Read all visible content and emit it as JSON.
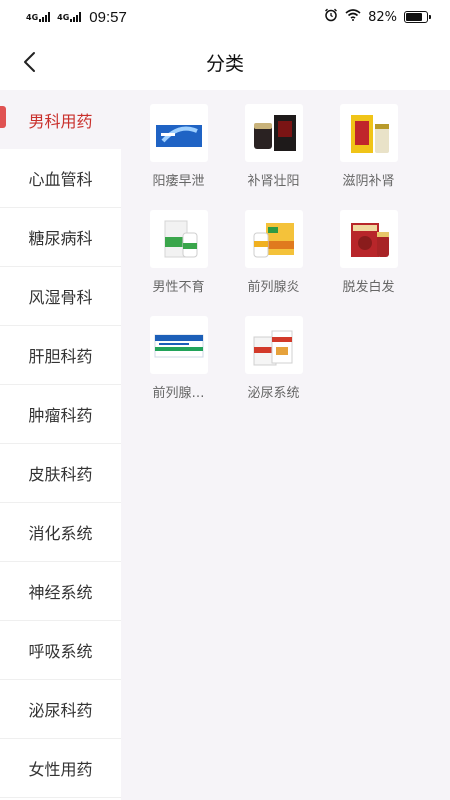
{
  "status_bar": {
    "net1": "4G",
    "net2": "4G",
    "time": "09:57",
    "battery": "82%",
    "battery_level": 0.82
  },
  "header": {
    "title": "分类"
  },
  "sidebar": {
    "items": [
      {
        "label": "男科用药",
        "active": true
      },
      {
        "label": "心血管科",
        "active": false
      },
      {
        "label": "糖尿病科",
        "active": false
      },
      {
        "label": "风湿骨科",
        "active": false
      },
      {
        "label": "肝胆科药",
        "active": false
      },
      {
        "label": "肿瘤科药",
        "active": false
      },
      {
        "label": "皮肤科药",
        "active": false
      },
      {
        "label": "消化系统",
        "active": false
      },
      {
        "label": "神经系统",
        "active": false
      },
      {
        "label": "呼吸系统",
        "active": false
      },
      {
        "label": "泌尿科药",
        "active": false
      },
      {
        "label": "女性用药",
        "active": false
      }
    ]
  },
  "categories": [
    {
      "label": "阳痿早泄",
      "icon": "blue-medicine-box-icon"
    },
    {
      "label": "补肾壮阳",
      "icon": "black-medicine-box-icon"
    },
    {
      "label": "滋阴补肾",
      "icon": "yellow-red-medicine-box-icon"
    },
    {
      "label": "男性不育",
      "icon": "green-white-medicine-box-icon"
    },
    {
      "label": "前列腺炎",
      "icon": "yellow-orange-medicine-box-icon"
    },
    {
      "label": "脱发白发",
      "icon": "red-medicine-box-icon"
    },
    {
      "label": "前列腺…",
      "icon": "blue-green-medicine-box-icon"
    },
    {
      "label": "泌尿系统",
      "icon": "white-red-medicine-box-icon"
    }
  ],
  "colors": {
    "accent": "#c9302c",
    "indicator": "#e05252",
    "content_bg": "#f6f4f8"
  }
}
